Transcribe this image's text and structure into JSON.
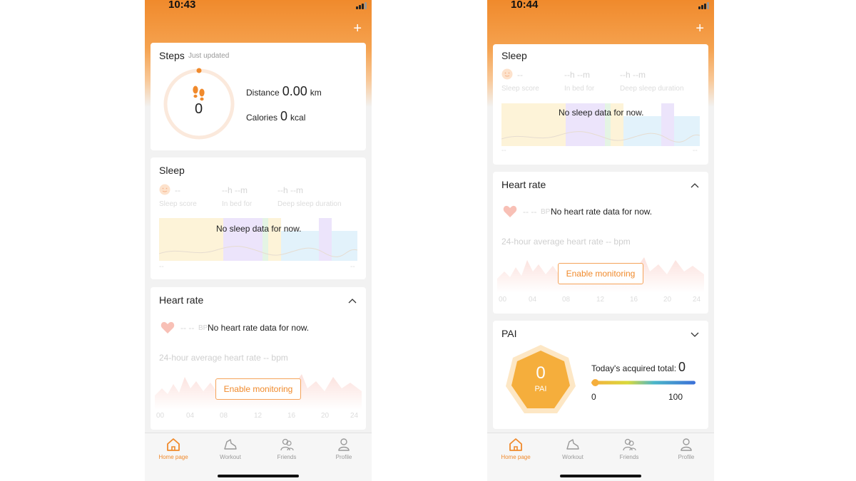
{
  "left": {
    "time": "10:43",
    "steps": {
      "title": "Steps",
      "subtitle": "Just updated",
      "value": "0",
      "distance_label": "Distance",
      "distance_value": "0.00",
      "distance_unit": "km",
      "calories_label": "Calories",
      "calories_value": "0",
      "calories_unit": "kcal"
    },
    "sleep": {
      "title": "Sleep",
      "score_value": "--",
      "score_label": "Sleep score",
      "inbed_value": "--h --m",
      "inbed_label": "In bed for",
      "deep_value": "--h --m",
      "deep_label": "Deep sleep duration",
      "no_data": "No sleep data for now.",
      "axis_left": "--",
      "axis_right": "--"
    },
    "heart": {
      "title": "Heart rate",
      "bpm_value": "-- --",
      "bpm_unit": "BP",
      "no_data": "No heart rate data for now.",
      "avg_text": "24-hour average heart rate -- bpm",
      "enable": "Enable monitoring",
      "hours": [
        "00",
        "04",
        "08",
        "12",
        "16",
        "20",
        "24"
      ]
    }
  },
  "right": {
    "time": "10:44",
    "sleep": {
      "title": "Sleep",
      "score_value": "--",
      "score_label": "Sleep score",
      "inbed_value": "--h --m",
      "inbed_label": "In bed for",
      "deep_value": "--h --m",
      "deep_label": "Deep sleep duration",
      "no_data": "No sleep data for now.",
      "axis_left": "--",
      "axis_right": "--"
    },
    "heart": {
      "title": "Heart rate",
      "bpm_value": "-- --",
      "bpm_unit": "BP",
      "no_data": "No heart rate data for now.",
      "avg_text": "24-hour average heart rate -- bpm",
      "enable": "Enable monitoring",
      "hours": [
        "00",
        "04",
        "08",
        "12",
        "16",
        "20",
        "24"
      ]
    },
    "pai": {
      "title": "PAI",
      "value": "0",
      "label": "PAI",
      "today_label": "Today's acquired total:",
      "today_value": "0",
      "scale_min": "0",
      "scale_max": "100",
      "progress": 0
    }
  },
  "tabs": [
    "Home page",
    "Workout",
    "Friends",
    "Profile"
  ],
  "colors": {
    "accent": "#f08a2c",
    "pai_hex": "#f5ae3c",
    "heart": "#f8b8b0"
  }
}
